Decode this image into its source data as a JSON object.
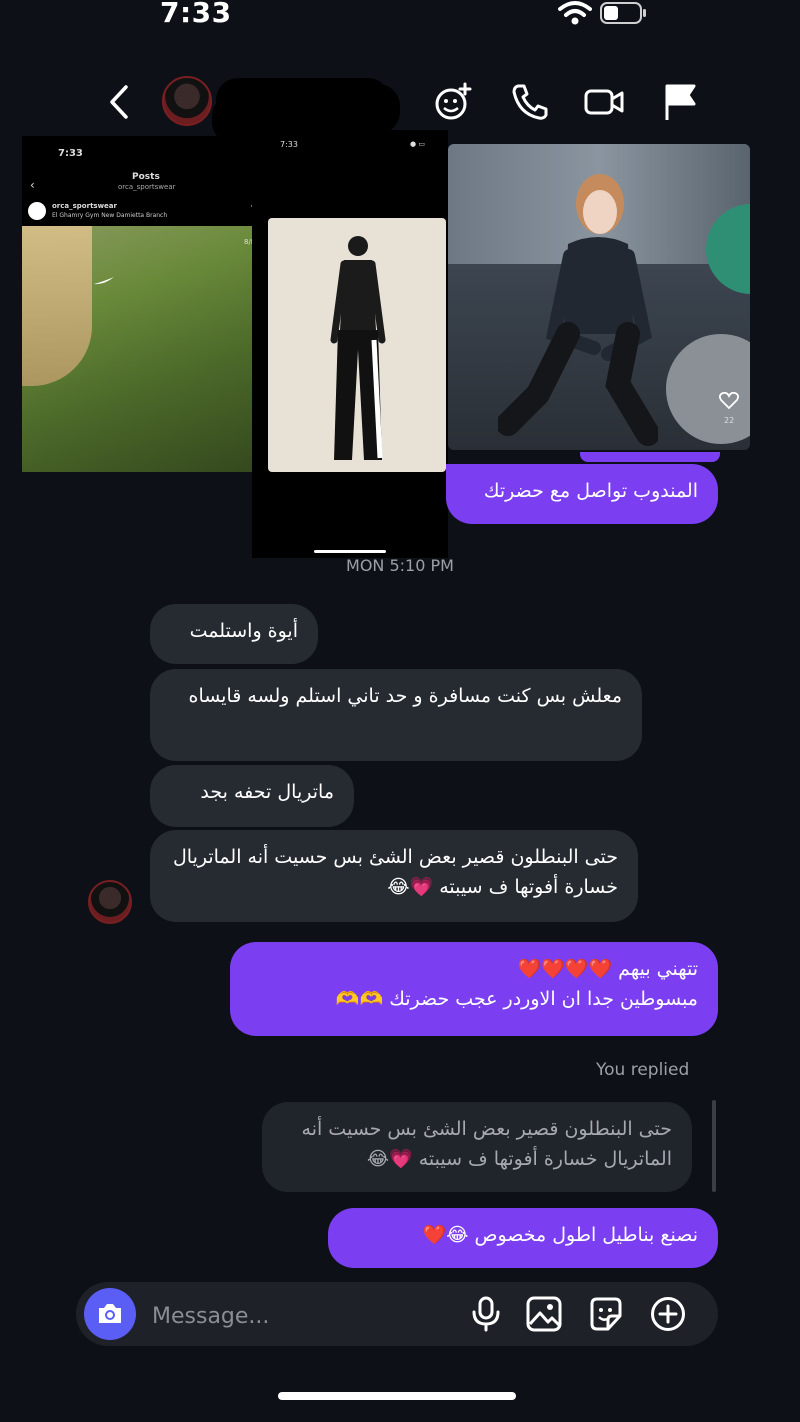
{
  "status_bar": {
    "time": "7:33"
  },
  "header": {
    "contact_name_redacted": true
  },
  "shared_media": {
    "post_screenshot": {
      "time": "7:33",
      "title": "Posts",
      "handle": "orca_sportswear",
      "account": "orca_sportswear",
      "location": "El Ghamry Gym New Damietta Branch",
      "counter": "8/8"
    },
    "second_screenshot": {
      "time": "7:33"
    },
    "gym_photo": {
      "likes": "22"
    }
  },
  "messages": {
    "out_partial": "المندوب تواصل مع حضرتك",
    "timestamp": "MON 5:10 PM",
    "in_1": "أيوة واستلمت",
    "in_2": "معلش بس كنت مسافرة و حد تاني استلم ولسه قايساه",
    "in_3": "ماتريال تحفه بجد",
    "in_4": "حتى البنطلون قصير بعض الشئ بس حسيت أنه الماتريال خسارة أفوتها ف سيبته 💗😂",
    "out_1_line1": "تتهني بيهم ❤️❤️❤️❤️",
    "out_1_line2": "مبسوطين جدا ان الاوردر عجب حضرتك 🫶🫶",
    "replied_label": "You replied",
    "quoted": "حتى البنطلون قصير بعض الشئ بس حسيت أنه الماتريال خسارة أفوتها ف سيبته 💗😂",
    "out_2": "نصنع بناطيل اطول مخصوص 😂❤️"
  },
  "composer": {
    "placeholder": "Message..."
  },
  "icons": [
    "wifi-icon",
    "battery-icon",
    "back-icon",
    "avatar",
    "effects-icon",
    "phone-icon",
    "video-icon",
    "flag-icon",
    "camera-icon",
    "mic-icon",
    "gallery-icon",
    "sticker-icon",
    "plus-icon",
    "heart-icon"
  ],
  "colors": {
    "background": "#0d1117",
    "outgoing": "#7b3ef0",
    "incoming": "#262a31",
    "camera": "#5a5ef5"
  }
}
